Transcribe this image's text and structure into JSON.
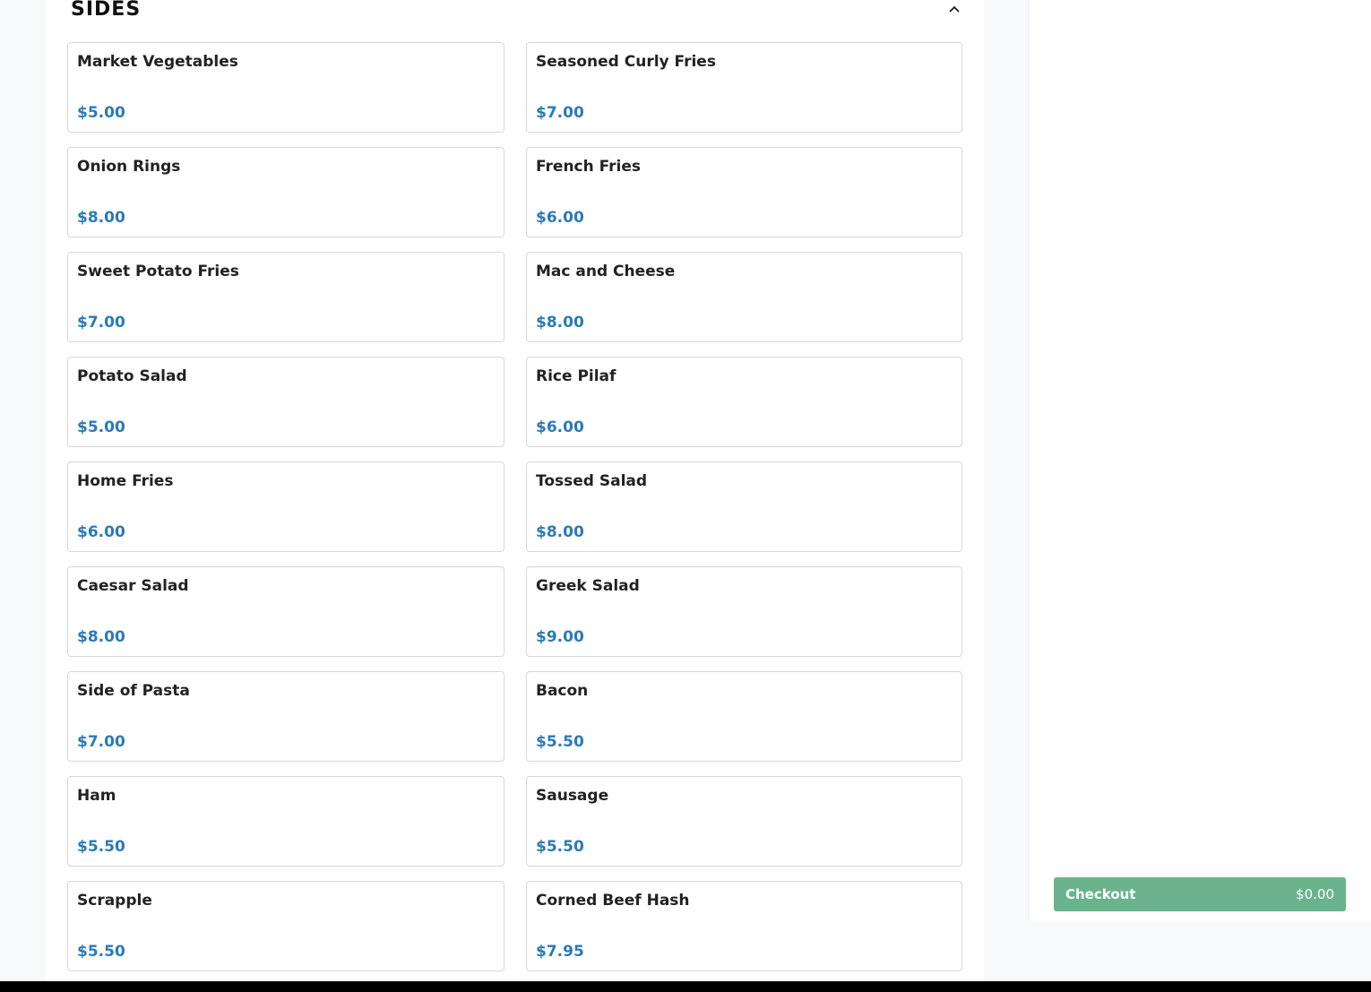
{
  "section": {
    "title": "SIDES",
    "toggle_icon": "chevron-up-icon"
  },
  "items": [
    {
      "name": "Market Vegetables",
      "price": "$5.00"
    },
    {
      "name": "Seasoned Curly Fries",
      "price": "$7.00"
    },
    {
      "name": "Onion Rings",
      "price": "$8.00"
    },
    {
      "name": "French Fries",
      "price": "$6.00"
    },
    {
      "name": "Sweet Potato Fries",
      "price": "$7.00"
    },
    {
      "name": "Mac and Cheese",
      "price": "$8.00"
    },
    {
      "name": "Potato Salad",
      "price": "$5.00"
    },
    {
      "name": "Rice Pilaf",
      "price": "$6.00"
    },
    {
      "name": "Home Fries",
      "price": "$6.00"
    },
    {
      "name": "Tossed Salad",
      "price": "$8.00"
    },
    {
      "name": "Caesar Salad",
      "price": "$8.00"
    },
    {
      "name": "Greek Salad",
      "price": "$9.00"
    },
    {
      "name": "Side of Pasta",
      "price": "$7.00"
    },
    {
      "name": "Bacon",
      "price": "$5.50"
    },
    {
      "name": "Ham",
      "price": "$5.50"
    },
    {
      "name": "Sausage",
      "price": "$5.50"
    },
    {
      "name": "Scrapple",
      "price": "$5.50"
    },
    {
      "name": "Corned Beef Hash",
      "price": "$7.95"
    }
  ],
  "checkout": {
    "label": "Checkout",
    "total": "$0.00"
  },
  "colors": {
    "price": "#2a7ab8",
    "checkout_bg": "#6bb38d",
    "card_border": "#d7d7d7"
  }
}
